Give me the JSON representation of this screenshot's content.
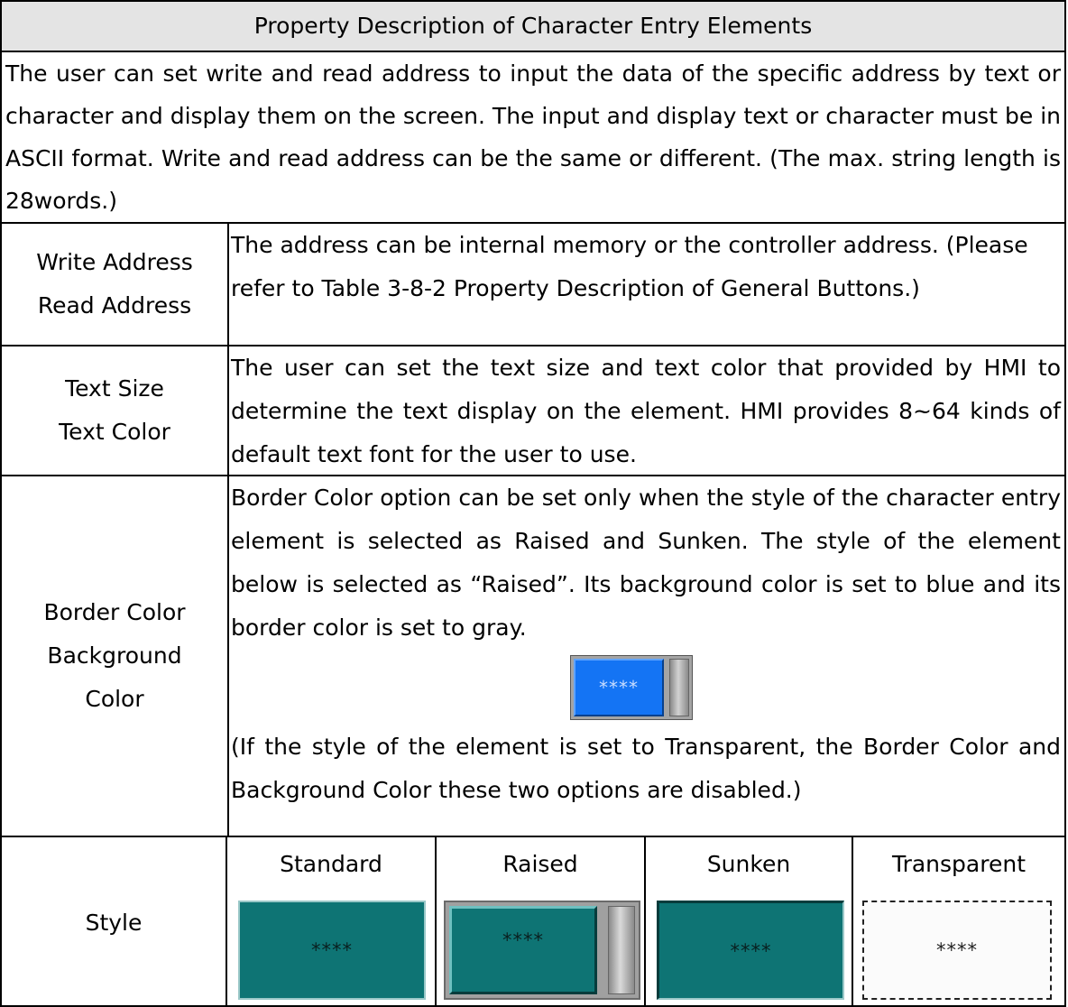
{
  "header": {
    "title": "Property Description of Character Entry Elements"
  },
  "intro": {
    "text": "The user can set write and read address to input the data of the specific address by text or character and display them on the screen. The input and display text or character must be in ASCII format. Write and read address can be the same or different. (The max. string length is 28words.)"
  },
  "rows": {
    "address": {
      "label_line1": "Write Address",
      "label_line2": "Read Address",
      "description": "The address can be internal memory or the controller address. (Please refer to Table 3-8-2 Property Description of General Buttons.)"
    },
    "text": {
      "label_line1": "Text Size",
      "label_line2": "Text Color",
      "description": "The user can set the text size and text color that provided by HMI to determine the text display on the element. HMI provides 8~64 kinds of default text font for the user to use."
    },
    "border": {
      "label_line1": "Border Color",
      "label_line2": "Background",
      "label_line3": "Color",
      "description": "Border Color option can be set only when the style of the character entry element is selected as Raised and Sunken. The style of the element below is selected as “Raised”. Its background color is set to blue and its border color is set to gray.",
      "sample_text": "****",
      "note": "(If the style of the element is set to Transparent, the Border Color and Background Color these two options are disabled.)"
    },
    "style": {
      "label": "Style",
      "options": [
        {
          "name": "Standard",
          "sample": "****"
        },
        {
          "name": "Raised",
          "sample": "****"
        },
        {
          "name": "Sunken",
          "sample": "****"
        },
        {
          "name": "Transparent",
          "sample": "****"
        }
      ]
    }
  },
  "colors": {
    "header_bg": "#e4e4e4",
    "sample_blue": "#1474f4",
    "teal": "#0e7474",
    "gray_border": "#a0a0a0"
  }
}
